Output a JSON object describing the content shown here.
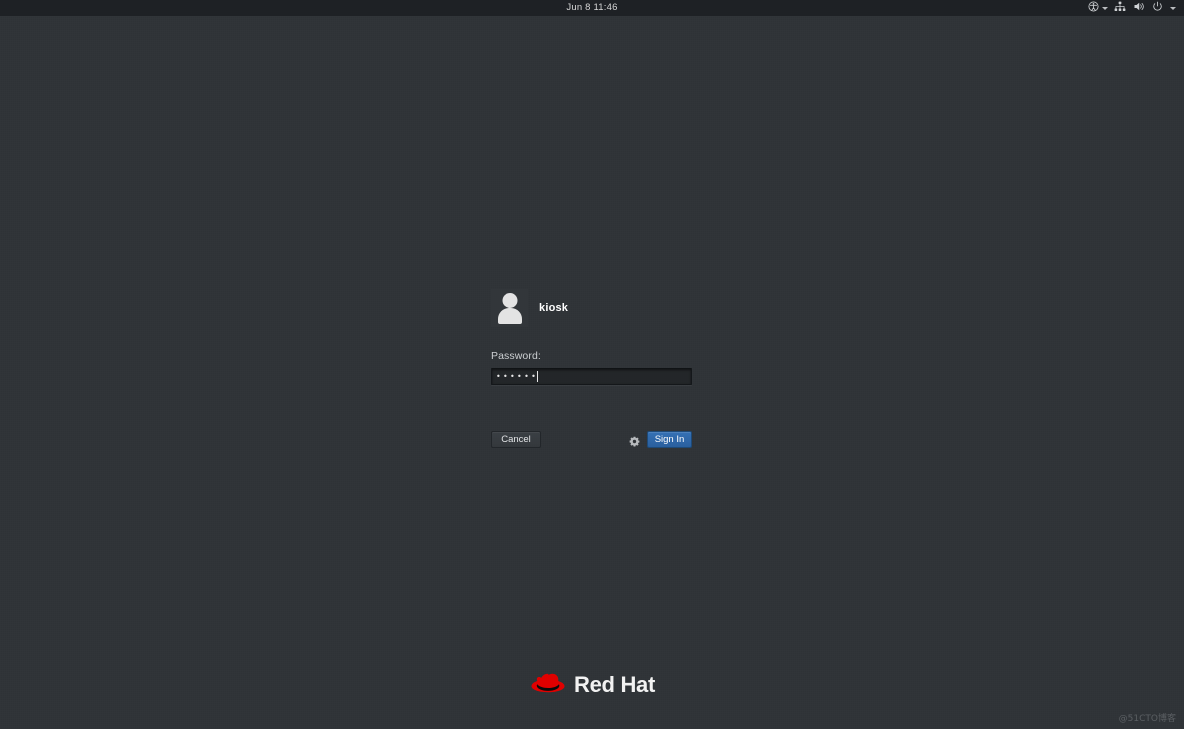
{
  "colors": {
    "desktop_background": "#2f3337",
    "top_bar_background": "#1e2125",
    "accent_blue": "#2a5f9e",
    "brand_red": "#e00000",
    "text_primary": "#e6e6e6",
    "field_background": "#232629"
  },
  "top_bar": {
    "clock": "Jun 8  11:46",
    "tray": [
      {
        "icon": "accessibility-icon",
        "label": "Accessibility"
      },
      {
        "icon": "chevron-down-icon",
        "label": "Accessibility menu"
      },
      {
        "icon": "network-icon",
        "label": "Network"
      },
      {
        "icon": "volume-icon",
        "label": "Volume"
      },
      {
        "icon": "power-icon",
        "label": "Power"
      },
      {
        "icon": "chevron-down-icon",
        "label": "System menu"
      }
    ]
  },
  "login": {
    "avatar_icon": "user-avatar-icon",
    "username": "kiosk",
    "password_label": "Password:",
    "password_value": "••••••",
    "password_char_count": 6,
    "cancel_label": "Cancel",
    "signin_label": "Sign In",
    "session_icon": "gear-icon"
  },
  "brand": {
    "logo_icon": "red-hat-fedora-icon",
    "name": "Red Hat"
  },
  "watermark": {
    "text": "@51CTO博客"
  }
}
